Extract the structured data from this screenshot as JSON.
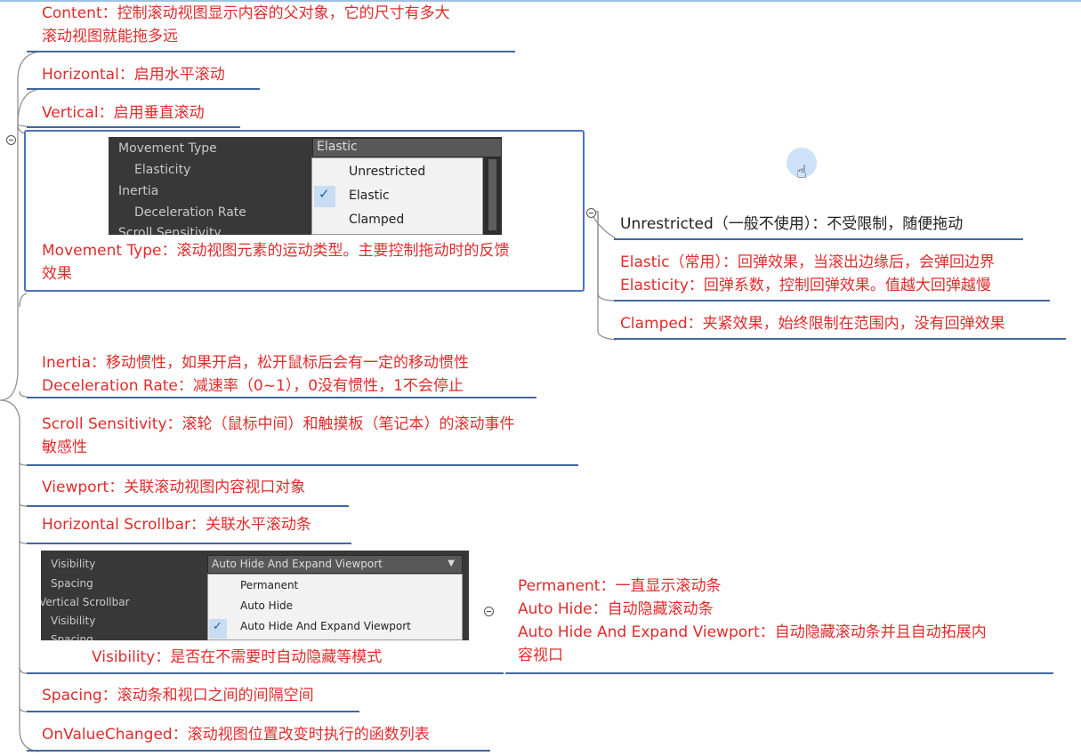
{
  "nodes": {
    "content_1": "Content：控制滚动视图显示内容的父对象，它的尺寸有多大",
    "content_2": "滚动视图就能拖多远",
    "horizontal": "Horizontal：启用水平滚动",
    "vertical": "Vertical：启用垂直滚动",
    "movement_1": "Movement Type：滚动视图元素的运动类型。主要控制拖动时的反馈",
    "movement_2": "效果",
    "inertia": "Inertia：移动惯性，如果开启，松开鼠标后会有一定的移动惯性",
    "deceleration": "Deceleration Rate：减速率（0~1），0没有惯性，1不会停止",
    "scroll_sens_1": "Scroll Sensitivity：滚轮（鼠标中间）和触摸板（笔记本）的滚动事件",
    "scroll_sens_2": "敏感性",
    "viewport": "Viewport：关联滚动视图内容视口对象",
    "hscrollbar": "Horizontal Scrollbar：关联水平滚动条",
    "visibility": "Visibility：是否在不需要时自动隐藏等模式",
    "spacing": "Spacing：滚动条和视口之间的间隔空间",
    "onvaluechanged": "OnValueChanged：滚动视图位置改变时执行的函数列表"
  },
  "movement_children": {
    "unrestricted": "Unrestricted（一般不使用）：不受限制，随便拖动",
    "elastic": "Elastic（常用）：回弹效果，当滚出边缘后，会弹回边界",
    "elasticity": "Elasticity：回弹系数，控制回弹效果。值越大回弹越慢",
    "clamped": "Clamped：夹紧效果，始终限制在范围内，没有回弹效果"
  },
  "visibility_children": {
    "permanent": "Permanent：一直显示滚动条",
    "auto_hide": "Auto Hide：自动隐藏滚动条",
    "auto_expand_1": "Auto Hide And Expand Viewport：自动隐藏滚动条并且自动拓展内",
    "auto_expand_2": "容视口"
  },
  "inspector_movement": {
    "labels": [
      "Movement Type",
      "Elasticity",
      "Inertia",
      "Deceleration Rate",
      "Scroll Sensitivity"
    ],
    "field_value": "Elastic",
    "options": [
      "Unrestricted",
      "Elastic",
      "Clamped"
    ],
    "selected": "Elastic"
  },
  "inspector_visibility": {
    "labels": [
      "Visibility",
      "Spacing",
      "Vertical Scrollbar",
      "Visibility",
      "Spacing"
    ],
    "field_value": "Auto Hide And Expand Viewport",
    "options": [
      "Permanent",
      "Auto Hide",
      "Auto Hide And Expand Viewport"
    ],
    "selected": "Auto Hide And Expand Viewport"
  },
  "colors": {
    "text_red": "#e12b2b",
    "underline_blue": "#41679f",
    "selection_border": "#4c72bd",
    "branch_gray": "#909090"
  }
}
